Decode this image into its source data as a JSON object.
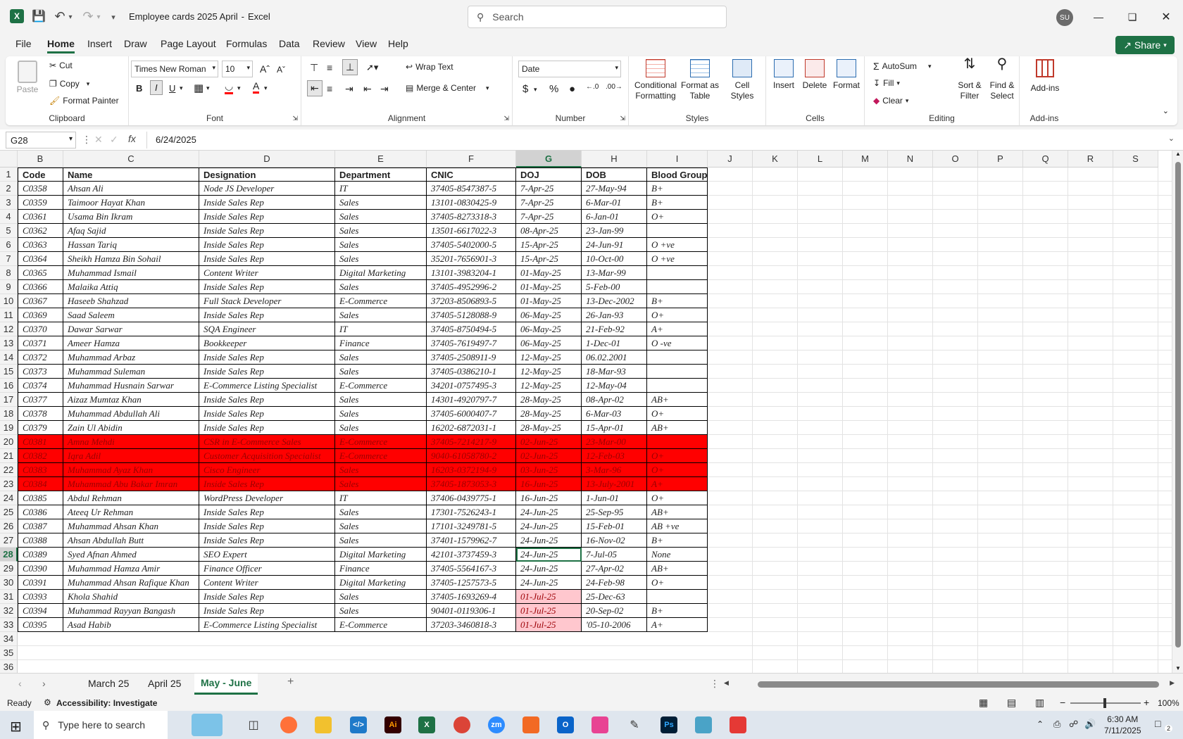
{
  "titlebar": {
    "doc_title": "Employee cards 2025 April",
    "app_name": "Excel",
    "title_separator": "-",
    "search_placeholder": "Search",
    "user_initials": "SU"
  },
  "menu": [
    "File",
    "Home",
    "Insert",
    "Draw",
    "Page Layout",
    "Formulas",
    "Data",
    "Review",
    "View",
    "Help"
  ],
  "share_label": "Share",
  "ribbon": {
    "clipboard": {
      "paste": "Paste",
      "cut": "Cut",
      "copy": "Copy",
      "format_painter": "Format Painter",
      "label": "Clipboard"
    },
    "font": {
      "name": "Times New Roman",
      "size": "10",
      "bold": "B",
      "italic": "I",
      "underline": "U",
      "label": "Font"
    },
    "alignment": {
      "wrap": "Wrap Text",
      "merge": "Merge & Center",
      "label": "Alignment"
    },
    "number": {
      "format": "Date",
      "label": "Number"
    },
    "styles": {
      "cond": "Conditional Formatting",
      "table": "Format as Table",
      "cell": "Cell Styles",
      "label": "Styles"
    },
    "cells": {
      "insert": "Insert",
      "delete": "Delete",
      "format": "Format",
      "label": "Cells"
    },
    "editing": {
      "autosum": "AutoSum",
      "fill": "Fill",
      "clear": "Clear",
      "sort": "Sort & Filter",
      "find": "Find & Select",
      "label": "Editing"
    },
    "addins": {
      "addins": "Add-ins",
      "label": "Add-ins"
    }
  },
  "formula_bar": {
    "name_box": "G28",
    "formula": "6/24/2025"
  },
  "columns": [
    "B",
    "C",
    "D",
    "E",
    "F",
    "G",
    "H",
    "I",
    "J",
    "K",
    "L",
    "M",
    "N",
    "O",
    "P",
    "Q",
    "R",
    "S"
  ],
  "header_row": [
    "Code",
    "Name",
    "Designation",
    "Department",
    "CNIC",
    "DOJ",
    "DOB",
    "Blood Group"
  ],
  "rows": [
    {
      "n": "2",
      "cells": [
        "C0358",
        "Ahsan Ali",
        "Node JS Developer",
        "IT",
        "37405-8547387-5",
        "7-Apr-25",
        "27-May-94",
        "B+"
      ]
    },
    {
      "n": "3",
      "cells": [
        "C0359",
        "Taimoor Hayat Khan",
        "Inside Sales Rep",
        "Sales",
        "13101-0830425-9",
        "7-Apr-25",
        "6-Mar-01",
        "B+"
      ]
    },
    {
      "n": "4",
      "cells": [
        "C0361",
        "Usama Bin Ikram",
        "Inside Sales Rep",
        "Sales",
        "37405-8273318-3",
        "7-Apr-25",
        "6-Jan-01",
        "O+"
      ]
    },
    {
      "n": "5",
      "cells": [
        "C0362",
        "Afaq Sajid",
        "Inside Sales Rep",
        "Sales",
        "13501-6617022-3",
        "08-Apr-25",
        "23-Jan-99",
        ""
      ]
    },
    {
      "n": "6",
      "cells": [
        "C0363",
        "Hassan Tariq",
        "Inside Sales Rep",
        "Sales",
        "37405-5402000-5",
        "15-Apr-25",
        "24-Jun-91",
        "O +ve"
      ]
    },
    {
      "n": "7",
      "cells": [
        "C0364",
        "Sheikh Hamza Bin Sohail",
        "Inside Sales Rep",
        "Sales",
        "35201-7656901-3",
        "15-Apr-25",
        "10-Oct-00",
        "O +ve"
      ]
    },
    {
      "n": "8",
      "cells": [
        "C0365",
        "Muhammad Ismail",
        "Content Writer",
        "Digital Marketing",
        "13101-3983204-1",
        "01-May-25",
        "13-Mar-99",
        ""
      ]
    },
    {
      "n": "9",
      "cells": [
        "C0366",
        "Malaika Attiq",
        "Inside Sales Rep",
        "Sales",
        "37405-4952996-2",
        "01-May-25",
        "5-Feb-00",
        ""
      ]
    },
    {
      "n": "10",
      "cells": [
        "C0367",
        "Haseeb Shahzad",
        "Full Stack Developer",
        "E-Commerce",
        "37203-8506893-5",
        "01-May-25",
        "13-Dec-2002",
        "B+"
      ]
    },
    {
      "n": "11",
      "cells": [
        "C0369",
        "Saad Saleem",
        "Inside Sales Rep",
        "Sales",
        "37405-5128088-9",
        "06-May-25",
        "26-Jan-93",
        "O+"
      ]
    },
    {
      "n": "12",
      "cells": [
        "C0370",
        "Dawar Sarwar",
        "SQA Engineer",
        "IT",
        "37405-8750494-5",
        "06-May-25",
        "21-Feb-92",
        "A+"
      ]
    },
    {
      "n": "13",
      "cells": [
        "C0371",
        "Ameer Hamza",
        "Bookkeeper",
        "Finance",
        "37405-7619497-7",
        "06-May-25",
        "1-Dec-01",
        "O -ve"
      ]
    },
    {
      "n": "14",
      "cells": [
        "C0372",
        "Muhammad Arbaz",
        "Inside Sales Rep",
        "Sales",
        "37405-2508911-9",
        "12-May-25",
        "06.02.2001",
        ""
      ]
    },
    {
      "n": "15",
      "cells": [
        "C0373",
        "Muhammad Suleman",
        "Inside Sales Rep",
        "Sales",
        "37405-0386210-1",
        "12-May-25",
        "18-Mar-93",
        ""
      ]
    },
    {
      "n": "16",
      "cells": [
        "C0374",
        "Muhammad Husnain Sarwar",
        "E-Commerce Listing Specialist",
        "E-Commerce",
        "34201-0757495-3",
        "12-May-25",
        "12-May-04",
        ""
      ]
    },
    {
      "n": "17",
      "cells": [
        "C0377",
        "Aizaz Mumtaz Khan",
        "Inside Sales Rep",
        "Sales",
        "14301-4920797-7",
        "28-May-25",
        "08-Apr-02",
        "AB+"
      ]
    },
    {
      "n": "18",
      "cells": [
        "C0378",
        "Muhammad Abdullah Ali",
        "Inside Sales Rep",
        "Sales",
        "37405-6000407-7",
        "28-May-25",
        "6-Mar-03",
        "O+"
      ]
    },
    {
      "n": "19",
      "cells": [
        "C0379",
        "Zain Ul Abidin",
        "Inside Sales Rep",
        "Sales",
        "16202-6872031-1",
        "28-May-25",
        "15-Apr-01",
        "AB+"
      ]
    },
    {
      "n": "20",
      "red": true,
      "cells": [
        "C0381",
        "Amna Mehdi",
        "CSR in E-Commerce Sales",
        "E-Commerce",
        "37405-7214217-9",
        "02-Jun-25",
        "23-Mar-00",
        ""
      ]
    },
    {
      "n": "21",
      "red": true,
      "cells": [
        "C0382",
        "Iqra Adil",
        "Customer Acquisition Specialist",
        "E-Commerce",
        "9040-61058780-2",
        "02-Jun-25",
        "12-Feb-03",
        "O+"
      ]
    },
    {
      "n": "22",
      "red": true,
      "cells": [
        "C0383",
        "Muhammad Ayaz Khan",
        "Cisco Engineer",
        "Sales",
        "16203-0372194-9",
        "03-Jun-25",
        "3-Mar-96",
        "O+"
      ]
    },
    {
      "n": "23",
      "red": true,
      "cells": [
        "C0384",
        "Muhammad Abu Bakar Imran",
        "Inside Sales Rep",
        "Sales",
        "37405-1873053-3",
        "16-Jun-25",
        "13-July-2001",
        "A+"
      ]
    },
    {
      "n": "24",
      "cells": [
        "C0385",
        "Abdul Rehman",
        "WordPress Developer",
        "IT",
        "37406-0439775-1",
        "16-Jun-25",
        "1-Jun-01",
        "O+"
      ]
    },
    {
      "n": "25",
      "cells": [
        "C0386",
        "Ateeq Ur Rehman",
        "Inside Sales Rep",
        "Sales",
        "17301-7526243-1",
        "24-Jun-25",
        "25-Sep-95",
        "AB+"
      ]
    },
    {
      "n": "26",
      "cells": [
        "C0387",
        "Muhammad Ahsan Khan",
        "Inside Sales Rep",
        "Sales",
        "17101-3249781-5",
        "24-Jun-25",
        "15-Feb-01",
        "AB +ve"
      ]
    },
    {
      "n": "27",
      "cells": [
        "C0388",
        "Ahsan Abdullah Butt",
        "Inside Sales Rep",
        "Sales",
        "37401-1579962-7",
        "24-Jun-25",
        "16-Nov-02",
        "B+"
      ]
    },
    {
      "n": "28",
      "cells": [
        "C0389",
        "Syed Afnan Ahmed",
        "SEO Expert",
        "Digital Marketing",
        "42101-3737459-3",
        "24-Jun-25",
        "7-Jul-05",
        "None"
      ]
    },
    {
      "n": "29",
      "cells": [
        "C0390",
        "Muhammad Hamza Amir",
        "Finance Officer",
        "Finance",
        "37405-5564167-3",
        "24-Jun-25",
        "27-Apr-02",
        "AB+"
      ]
    },
    {
      "n": "30",
      "cells": [
        "C0391",
        "Muhammad Ahsan Rafique Khan",
        "Content Writer",
        "Digital Marketing",
        "37405-1257573-5",
        "24-Jun-25",
        "24-Feb-98",
        "O+"
      ]
    },
    {
      "n": "31",
      "pinkdoj": true,
      "cells": [
        "C0393",
        "Khola Shahid",
        "Inside Sales Rep",
        "Sales",
        "37405-1693269-4",
        "01-Jul-25",
        "25-Dec-63",
        ""
      ]
    },
    {
      "n": "32",
      "pinkdoj": true,
      "cells": [
        "C0394",
        "Muhammad Rayyan Bangash",
        "Inside Sales Rep",
        "Sales",
        "90401-0119306-1",
        "01-Jul-25",
        "20-Sep-02",
        "B+"
      ]
    },
    {
      "n": "33",
      "pinkdoj": true,
      "cells": [
        "C0395",
        "Asad Habib",
        "E-Commerce Listing Specialist",
        "E-Commerce",
        "37203-3460818-3",
        "01-Jul-25",
        "'05-10-2006",
        "A+"
      ]
    }
  ],
  "empty_rows": [
    "34",
    "35",
    "36"
  ],
  "sheet_tabs": [
    "March 25",
    "April 25",
    "May - June"
  ],
  "active_tab": "May - June",
  "status": {
    "ready": "Ready",
    "accessibility": "Accessibility: Investigate",
    "zoom": "100%"
  },
  "taskbar": {
    "search_placeholder": "Type here to search",
    "time": "6:30 AM",
    "date": "7/11/2025",
    "notif_count": "2"
  },
  "colors": {
    "excel_green": "#1e7145",
    "red_fill": "#ff0000",
    "pink_fill": "#ffc7ce"
  }
}
